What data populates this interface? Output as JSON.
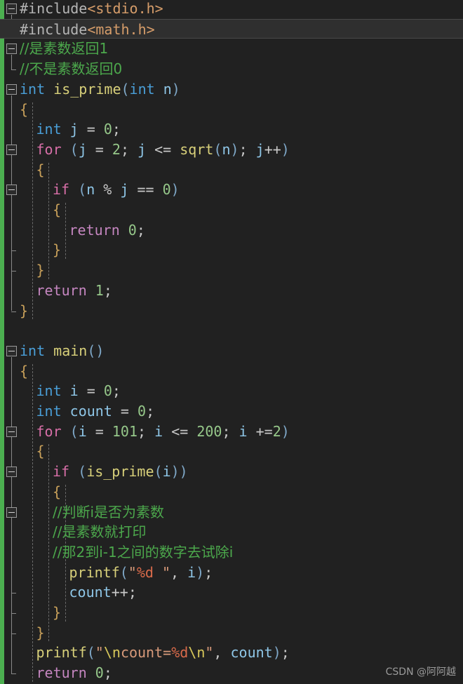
{
  "editor": {
    "language": "C",
    "background_color": "#212121",
    "current_line_color": "#2f2f2f",
    "change_bar_color": "#4caf50",
    "line_height": 28.7,
    "font_size": 20
  },
  "watermark": {
    "text": "CSDN @阿阿越"
  },
  "colors": {
    "preprocessor": "#b5b5b5",
    "header": "#d69d6a",
    "comment": "#4ca84c",
    "keyword": "#4a9fd8",
    "control": "#d86fa8",
    "return": "#c586c0",
    "function": "#d8d07a",
    "variable": "#8fc7e8",
    "number": "#96c88a",
    "string": "#d89a7a",
    "escape": "#d8c85a",
    "format": "#d86a4a",
    "brace": "#c8a05a",
    "paren": "#7fa8c8"
  },
  "code": {
    "plain_text": "#include<stdio.h>\n#include<math.h>\n//是素数返回1\n//不是素数返回0\nint is_prime(int n)\n{\n    int j = 0;\n    for (j = 2; j <= sqrt(n); j++)\n    {\n        if (n % j == 0)\n        {\n            return 0;\n        }\n    }\n    return 1;\n}\n\nint main()\n{\n    int i = 0;\n    int count = 0;\n    for (i = 101; i <= 200; i +=2)\n    {\n        if (is_prime(i))\n        {\n        //判断i是否为素数\n        //是素数就打印\n        //那2到i-1之间的数字去试除i\n            printf(\"%d \", i);\n            count++;\n        }\n    }\n    printf(\"\\ncount=%d\\n\", count);\n    return 0;",
    "lines": [
      {
        "n": 1,
        "current": false,
        "indent": 0,
        "tokens": [
          {
            "c": "t-pre",
            "t": "#include"
          },
          {
            "c": "t-header",
            "t": "<stdio.h>"
          }
        ]
      },
      {
        "n": 2,
        "current": true,
        "indent": 0,
        "tokens": [
          {
            "c": "t-pre",
            "t": "#include"
          },
          {
            "c": "t-header",
            "t": "<math.h>"
          }
        ]
      },
      {
        "n": 3,
        "current": false,
        "indent": 0,
        "tokens": [
          {
            "c": "t-comment cn",
            "t": "//是素数返回1"
          }
        ]
      },
      {
        "n": 4,
        "current": false,
        "indent": 0,
        "tokens": [
          {
            "c": "t-comment cn",
            "t": "//不是素数返回0"
          }
        ]
      },
      {
        "n": 5,
        "current": false,
        "indent": 0,
        "tokens": [
          {
            "c": "t-kw",
            "t": "int"
          },
          {
            "c": "t-punct",
            "t": " "
          },
          {
            "c": "t-fn",
            "t": "is_prime"
          },
          {
            "c": "t-paren",
            "t": "("
          },
          {
            "c": "t-kw",
            "t": "int"
          },
          {
            "c": "t-punct",
            "t": " "
          },
          {
            "c": "t-var",
            "t": "n"
          },
          {
            "c": "t-paren",
            "t": ")"
          }
        ]
      },
      {
        "n": 6,
        "current": false,
        "indent": 0,
        "tokens": [
          {
            "c": "t-brace",
            "t": "{"
          }
        ]
      },
      {
        "n": 7,
        "current": false,
        "indent": 1,
        "tokens": [
          {
            "c": "t-kw",
            "t": "int"
          },
          {
            "c": "t-punct",
            "t": " "
          },
          {
            "c": "t-var",
            "t": "j"
          },
          {
            "c": "t-op",
            "t": " = "
          },
          {
            "c": "t-num",
            "t": "0"
          },
          {
            "c": "t-punct",
            "t": ";"
          }
        ]
      },
      {
        "n": 8,
        "current": false,
        "indent": 1,
        "tokens": [
          {
            "c": "t-ctrl",
            "t": "for"
          },
          {
            "c": "t-punct",
            "t": " "
          },
          {
            "c": "t-paren",
            "t": "("
          },
          {
            "c": "t-var",
            "t": "j"
          },
          {
            "c": "t-op",
            "t": " = "
          },
          {
            "c": "t-num",
            "t": "2"
          },
          {
            "c": "t-punct",
            "t": "; "
          },
          {
            "c": "t-var",
            "t": "j"
          },
          {
            "c": "t-op",
            "t": " <= "
          },
          {
            "c": "t-fn",
            "t": "sqrt"
          },
          {
            "c": "t-paren",
            "t": "("
          },
          {
            "c": "t-var",
            "t": "n"
          },
          {
            "c": "t-paren",
            "t": ")"
          },
          {
            "c": "t-punct",
            "t": "; "
          },
          {
            "c": "t-var",
            "t": "j"
          },
          {
            "c": "t-op",
            "t": "++"
          },
          {
            "c": "t-paren",
            "t": ")"
          }
        ]
      },
      {
        "n": 9,
        "current": false,
        "indent": 1,
        "tokens": [
          {
            "c": "t-brace",
            "t": "{"
          }
        ]
      },
      {
        "n": 10,
        "current": false,
        "indent": 2,
        "tokens": [
          {
            "c": "t-ctrl",
            "t": "if"
          },
          {
            "c": "t-punct",
            "t": " "
          },
          {
            "c": "t-paren",
            "t": "("
          },
          {
            "c": "t-var",
            "t": "n"
          },
          {
            "c": "t-op",
            "t": " % "
          },
          {
            "c": "t-var",
            "t": "j"
          },
          {
            "c": "t-op",
            "t": " == "
          },
          {
            "c": "t-num",
            "t": "0"
          },
          {
            "c": "t-paren",
            "t": ")"
          }
        ]
      },
      {
        "n": 11,
        "current": false,
        "indent": 2,
        "tokens": [
          {
            "c": "t-brace",
            "t": "{"
          }
        ]
      },
      {
        "n": 12,
        "current": false,
        "indent": 3,
        "tokens": [
          {
            "c": "t-ret",
            "t": "return"
          },
          {
            "c": "t-punct",
            "t": " "
          },
          {
            "c": "t-num",
            "t": "0"
          },
          {
            "c": "t-punct",
            "t": ";"
          }
        ]
      },
      {
        "n": 13,
        "current": false,
        "indent": 2,
        "tokens": [
          {
            "c": "t-brace",
            "t": "}"
          }
        ]
      },
      {
        "n": 14,
        "current": false,
        "indent": 1,
        "tokens": [
          {
            "c": "t-brace",
            "t": "}"
          }
        ]
      },
      {
        "n": 15,
        "current": false,
        "indent": 1,
        "tokens": [
          {
            "c": "t-ret",
            "t": "return"
          },
          {
            "c": "t-punct",
            "t": " "
          },
          {
            "c": "t-num",
            "t": "1"
          },
          {
            "c": "t-punct",
            "t": ";"
          }
        ]
      },
      {
        "n": 16,
        "current": false,
        "indent": 0,
        "tokens": [
          {
            "c": "t-brace",
            "t": "}"
          }
        ]
      },
      {
        "n": 17,
        "current": false,
        "indent": 0,
        "tokens": []
      },
      {
        "n": 18,
        "current": false,
        "indent": 0,
        "tokens": [
          {
            "c": "t-kw",
            "t": "int"
          },
          {
            "c": "t-punct",
            "t": " "
          },
          {
            "c": "t-fn",
            "t": "main"
          },
          {
            "c": "t-paren",
            "t": "()"
          }
        ]
      },
      {
        "n": 19,
        "current": false,
        "indent": 0,
        "tokens": [
          {
            "c": "t-brace",
            "t": "{"
          }
        ]
      },
      {
        "n": 20,
        "current": false,
        "indent": 1,
        "tokens": [
          {
            "c": "t-kw",
            "t": "int"
          },
          {
            "c": "t-punct",
            "t": " "
          },
          {
            "c": "t-var",
            "t": "i"
          },
          {
            "c": "t-op",
            "t": " = "
          },
          {
            "c": "t-num",
            "t": "0"
          },
          {
            "c": "t-punct",
            "t": ";"
          }
        ]
      },
      {
        "n": 21,
        "current": false,
        "indent": 1,
        "tokens": [
          {
            "c": "t-kw",
            "t": "int"
          },
          {
            "c": "t-punct",
            "t": " "
          },
          {
            "c": "t-var",
            "t": "count"
          },
          {
            "c": "t-op",
            "t": " = "
          },
          {
            "c": "t-num",
            "t": "0"
          },
          {
            "c": "t-punct",
            "t": ";"
          }
        ]
      },
      {
        "n": 22,
        "current": false,
        "indent": 1,
        "tokens": [
          {
            "c": "t-ctrl",
            "t": "for"
          },
          {
            "c": "t-punct",
            "t": " "
          },
          {
            "c": "t-paren",
            "t": "("
          },
          {
            "c": "t-var",
            "t": "i"
          },
          {
            "c": "t-op",
            "t": " = "
          },
          {
            "c": "t-num",
            "t": "101"
          },
          {
            "c": "t-punct",
            "t": "; "
          },
          {
            "c": "t-var",
            "t": "i"
          },
          {
            "c": "t-op",
            "t": " <= "
          },
          {
            "c": "t-num",
            "t": "200"
          },
          {
            "c": "t-punct",
            "t": "; "
          },
          {
            "c": "t-var",
            "t": "i"
          },
          {
            "c": "t-op",
            "t": " +="
          },
          {
            "c": "t-num",
            "t": "2"
          },
          {
            "c": "t-paren",
            "t": ")"
          }
        ]
      },
      {
        "n": 23,
        "current": false,
        "indent": 1,
        "tokens": [
          {
            "c": "t-brace",
            "t": "{"
          }
        ]
      },
      {
        "n": 24,
        "current": false,
        "indent": 2,
        "tokens": [
          {
            "c": "t-ctrl",
            "t": "if"
          },
          {
            "c": "t-punct",
            "t": " "
          },
          {
            "c": "t-paren",
            "t": "("
          },
          {
            "c": "t-fn",
            "t": "is_prime"
          },
          {
            "c": "t-paren",
            "t": "("
          },
          {
            "c": "t-var",
            "t": "i"
          },
          {
            "c": "t-paren",
            "t": "))"
          }
        ]
      },
      {
        "n": 25,
        "current": false,
        "indent": 2,
        "tokens": [
          {
            "c": "t-brace",
            "t": "{"
          }
        ]
      },
      {
        "n": 26,
        "current": false,
        "indent": 2,
        "tokens": [
          {
            "c": "t-comment cn",
            "t": "//判断i是否为素数"
          }
        ]
      },
      {
        "n": 27,
        "current": false,
        "indent": 2,
        "tokens": [
          {
            "c": "t-comment cn",
            "t": "//是素数就打印"
          }
        ]
      },
      {
        "n": 28,
        "current": false,
        "indent": 2,
        "tokens": [
          {
            "c": "t-comment cn",
            "t": "//那2到i-1之间的数字去试除i"
          }
        ]
      },
      {
        "n": 29,
        "current": false,
        "indent": 3,
        "tokens": [
          {
            "c": "t-fn",
            "t": "printf"
          },
          {
            "c": "t-paren",
            "t": "("
          },
          {
            "c": "t-str",
            "t": "\""
          },
          {
            "c": "t-fmt",
            "t": "%d"
          },
          {
            "c": "t-str",
            "t": " \""
          },
          {
            "c": "t-punct",
            "t": ", "
          },
          {
            "c": "t-var",
            "t": "i"
          },
          {
            "c": "t-paren",
            "t": ")"
          },
          {
            "c": "t-punct",
            "t": ";"
          }
        ]
      },
      {
        "n": 30,
        "current": false,
        "indent": 3,
        "tokens": [
          {
            "c": "t-var",
            "t": "count"
          },
          {
            "c": "t-op",
            "t": "++"
          },
          {
            "c": "t-punct",
            "t": ";"
          }
        ]
      },
      {
        "n": 31,
        "current": false,
        "indent": 2,
        "tokens": [
          {
            "c": "t-brace",
            "t": "}"
          }
        ]
      },
      {
        "n": 32,
        "current": false,
        "indent": 1,
        "tokens": [
          {
            "c": "t-brace",
            "t": "}"
          }
        ]
      },
      {
        "n": 33,
        "current": false,
        "indent": 1,
        "tokens": [
          {
            "c": "t-fn",
            "t": "printf"
          },
          {
            "c": "t-paren",
            "t": "("
          },
          {
            "c": "t-str",
            "t": "\""
          },
          {
            "c": "t-esc",
            "t": "\\n"
          },
          {
            "c": "t-str",
            "t": "count="
          },
          {
            "c": "t-fmt",
            "t": "%d"
          },
          {
            "c": "t-esc",
            "t": "\\n"
          },
          {
            "c": "t-str",
            "t": "\""
          },
          {
            "c": "t-punct",
            "t": ", "
          },
          {
            "c": "t-var",
            "t": "count"
          },
          {
            "c": "t-paren",
            "t": ")"
          },
          {
            "c": "t-punct",
            "t": ";"
          }
        ]
      },
      {
        "n": 34,
        "current": false,
        "indent": 1,
        "tokens": [
          {
            "c": "t-ret",
            "t": "return"
          },
          {
            "c": "t-punct",
            "t": " "
          },
          {
            "c": "t-num",
            "t": "0"
          },
          {
            "c": "t-punct",
            "t": ";"
          }
        ]
      }
    ],
    "fold_markers": [
      {
        "name": "fold-include-block",
        "line": 1,
        "span_lines": 1
      },
      {
        "name": "fold-comment-block",
        "line": 3,
        "span_lines": 1
      },
      {
        "name": "fold-is-prime-fn",
        "line": 5,
        "span_lines": 11
      },
      {
        "name": "fold-for-loop-outer",
        "line": 8,
        "span_lines": 6
      },
      {
        "name": "fold-if-block",
        "line": 10,
        "span_lines": 3
      },
      {
        "name": "fold-main-fn",
        "line": 18,
        "span_lines": 16
      },
      {
        "name": "fold-for-loop-main",
        "line": 22,
        "span_lines": 10
      },
      {
        "name": "fold-if-prime-block",
        "line": 24,
        "span_lines": 7
      },
      {
        "name": "fold-comment-group",
        "line": 26,
        "span_lines": 4
      }
    ],
    "indent_guides": [
      {
        "indent": 1,
        "from_line": 6,
        "to_line": 16
      },
      {
        "indent": 2,
        "from_line": 9,
        "to_line": 14
      },
      {
        "indent": 3,
        "from_line": 11,
        "to_line": 13
      },
      {
        "indent": 1,
        "from_line": 19,
        "to_line": 34
      },
      {
        "indent": 2,
        "from_line": 23,
        "to_line": 32
      },
      {
        "indent": 3,
        "from_line": 25,
        "to_line": 31
      }
    ]
  }
}
